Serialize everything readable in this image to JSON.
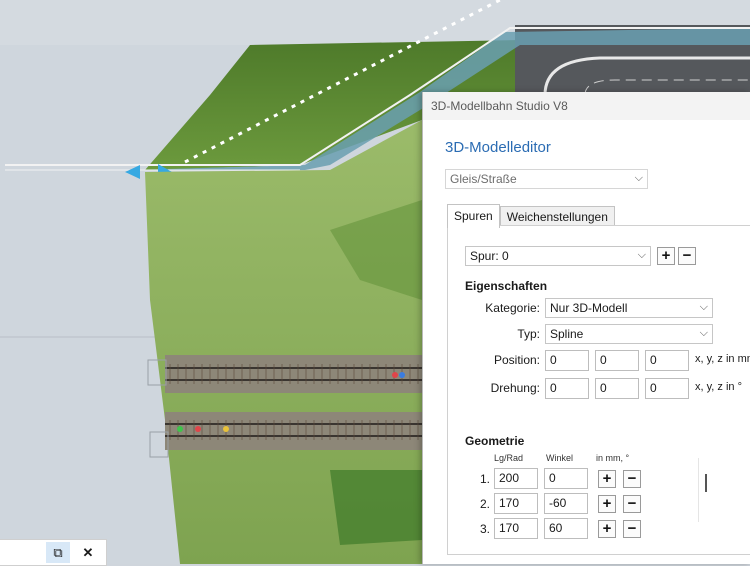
{
  "window": {
    "title": "3D-Modellbahn Studio V8"
  },
  "editor": {
    "heading": "3D-Modelleditor",
    "type_select": {
      "value": "Gleis/Straße"
    },
    "tabs": [
      {
        "label": "Spuren"
      },
      {
        "label": "Weichenstellungen"
      }
    ],
    "track_select": {
      "value": "Spur: 0"
    },
    "add_label": "+",
    "remove_label": "−",
    "properties": {
      "title": "Eigenschaften",
      "kategorie_label": "Kategorie:",
      "kategorie_value": "Nur 3D-Modell",
      "typ_label": "Typ:",
      "typ_value": "Spline",
      "position_label": "Position:",
      "position_values": [
        "0",
        "0",
        "0"
      ],
      "position_unit": "x, y, z in mm",
      "rotation_label": "Drehung:",
      "rotation_values": [
        "0",
        "0",
        "0"
      ],
      "rotation_unit": "x, y, z in °"
    },
    "geometry": {
      "title": "Geometrie",
      "col_lg": "Lg/Rad",
      "col_angle": "Winkel",
      "col_unit": "in mm, °",
      "rows": [
        {
          "index": "1.",
          "lg": "200",
          "angle": "0"
        },
        {
          "index": "2.",
          "lg": "170",
          "angle": "-60"
        },
        {
          "index": "3.",
          "lg": "170",
          "angle": "60"
        }
      ]
    }
  },
  "mini_toolbar": {
    "popout_icon": "⧉",
    "close_icon": "✕"
  },
  "colors": {
    "accent": "#2b6cb3",
    "terrain": "#5f8a3a",
    "track_bed": "#7c7464",
    "water": "#6a9fb0"
  }
}
